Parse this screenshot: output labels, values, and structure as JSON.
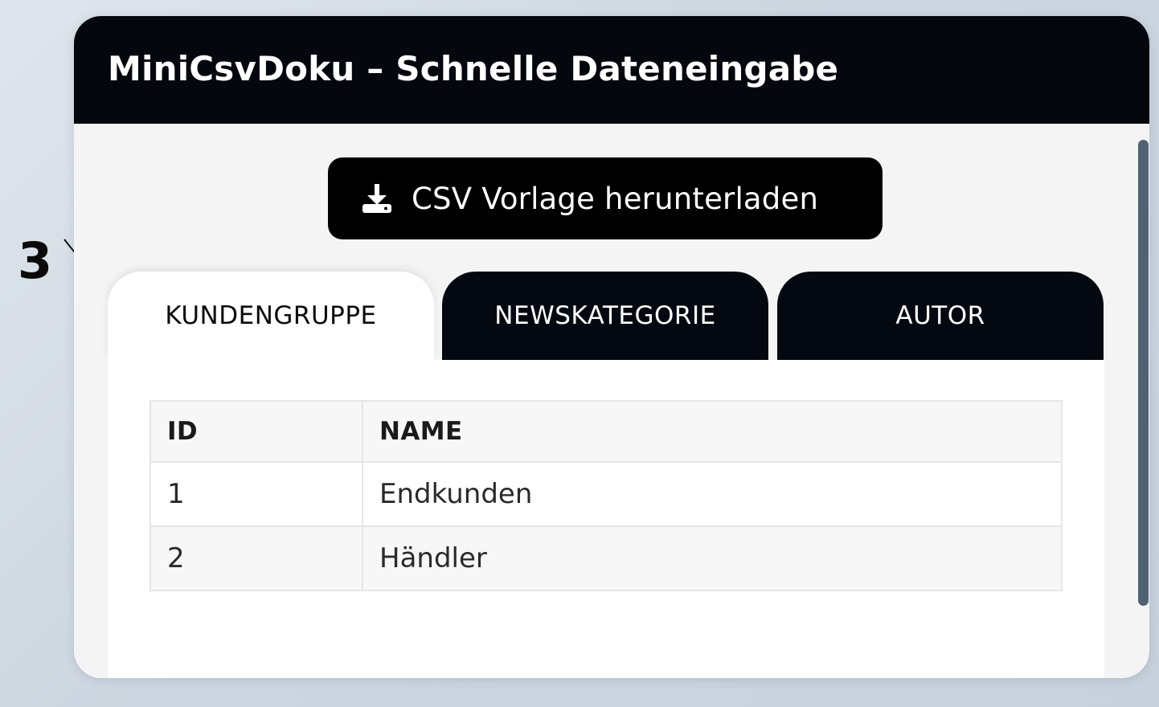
{
  "annotation": {
    "step_number": "3"
  },
  "window": {
    "title": "MiniCsvDoku – Schnelle Dateneingabe"
  },
  "toolbar": {
    "download_label": "CSV Vorlage herunterladen",
    "download_icon": "download-icon"
  },
  "tabs": [
    {
      "label": "KUNDENGRUPPE",
      "active": true
    },
    {
      "label": "NEWSKATEGORIE",
      "active": false
    },
    {
      "label": "AUTOR",
      "active": false
    }
  ],
  "table": {
    "columns": [
      "ID",
      "NAME"
    ],
    "rows": [
      {
        "id": "1",
        "name": "Endkunden"
      },
      {
        "id": "2",
        "name": "Händler"
      }
    ]
  },
  "colors": {
    "titlebar_bg": "#04070d",
    "tab_inactive_bg": "#040911",
    "button_bg": "#000000",
    "scrollbar": "#4f6172"
  }
}
